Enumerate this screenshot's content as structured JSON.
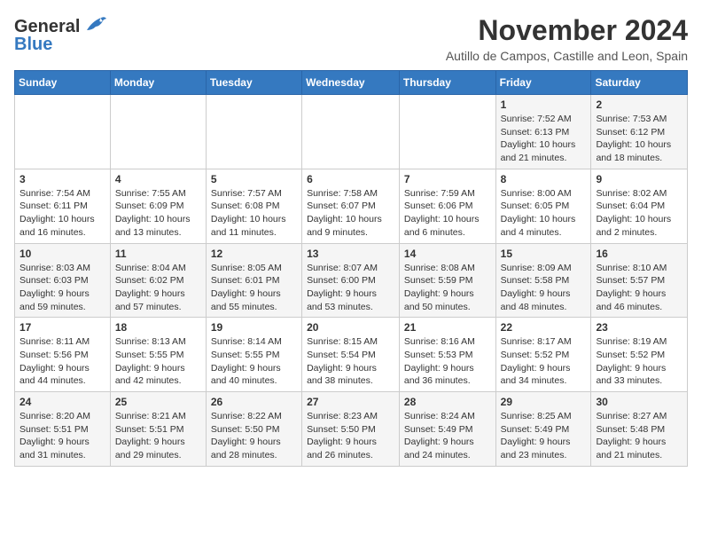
{
  "header": {
    "logo_line1": "General",
    "logo_line2": "Blue",
    "month_title": "November 2024",
    "location": "Autillo de Campos, Castille and Leon, Spain"
  },
  "weekdays": [
    "Sunday",
    "Monday",
    "Tuesday",
    "Wednesday",
    "Thursday",
    "Friday",
    "Saturday"
  ],
  "weeks": [
    [
      {
        "day": "",
        "info": ""
      },
      {
        "day": "",
        "info": ""
      },
      {
        "day": "",
        "info": ""
      },
      {
        "day": "",
        "info": ""
      },
      {
        "day": "",
        "info": ""
      },
      {
        "day": "1",
        "info": "Sunrise: 7:52 AM\nSunset: 6:13 PM\nDaylight: 10 hours and 21 minutes."
      },
      {
        "day": "2",
        "info": "Sunrise: 7:53 AM\nSunset: 6:12 PM\nDaylight: 10 hours and 18 minutes."
      }
    ],
    [
      {
        "day": "3",
        "info": "Sunrise: 7:54 AM\nSunset: 6:11 PM\nDaylight: 10 hours and 16 minutes."
      },
      {
        "day": "4",
        "info": "Sunrise: 7:55 AM\nSunset: 6:09 PM\nDaylight: 10 hours and 13 minutes."
      },
      {
        "day": "5",
        "info": "Sunrise: 7:57 AM\nSunset: 6:08 PM\nDaylight: 10 hours and 11 minutes."
      },
      {
        "day": "6",
        "info": "Sunrise: 7:58 AM\nSunset: 6:07 PM\nDaylight: 10 hours and 9 minutes."
      },
      {
        "day": "7",
        "info": "Sunrise: 7:59 AM\nSunset: 6:06 PM\nDaylight: 10 hours and 6 minutes."
      },
      {
        "day": "8",
        "info": "Sunrise: 8:00 AM\nSunset: 6:05 PM\nDaylight: 10 hours and 4 minutes."
      },
      {
        "day": "9",
        "info": "Sunrise: 8:02 AM\nSunset: 6:04 PM\nDaylight: 10 hours and 2 minutes."
      }
    ],
    [
      {
        "day": "10",
        "info": "Sunrise: 8:03 AM\nSunset: 6:03 PM\nDaylight: 9 hours and 59 minutes."
      },
      {
        "day": "11",
        "info": "Sunrise: 8:04 AM\nSunset: 6:02 PM\nDaylight: 9 hours and 57 minutes."
      },
      {
        "day": "12",
        "info": "Sunrise: 8:05 AM\nSunset: 6:01 PM\nDaylight: 9 hours and 55 minutes."
      },
      {
        "day": "13",
        "info": "Sunrise: 8:07 AM\nSunset: 6:00 PM\nDaylight: 9 hours and 53 minutes."
      },
      {
        "day": "14",
        "info": "Sunrise: 8:08 AM\nSunset: 5:59 PM\nDaylight: 9 hours and 50 minutes."
      },
      {
        "day": "15",
        "info": "Sunrise: 8:09 AM\nSunset: 5:58 PM\nDaylight: 9 hours and 48 minutes."
      },
      {
        "day": "16",
        "info": "Sunrise: 8:10 AM\nSunset: 5:57 PM\nDaylight: 9 hours and 46 minutes."
      }
    ],
    [
      {
        "day": "17",
        "info": "Sunrise: 8:11 AM\nSunset: 5:56 PM\nDaylight: 9 hours and 44 minutes."
      },
      {
        "day": "18",
        "info": "Sunrise: 8:13 AM\nSunset: 5:55 PM\nDaylight: 9 hours and 42 minutes."
      },
      {
        "day": "19",
        "info": "Sunrise: 8:14 AM\nSunset: 5:55 PM\nDaylight: 9 hours and 40 minutes."
      },
      {
        "day": "20",
        "info": "Sunrise: 8:15 AM\nSunset: 5:54 PM\nDaylight: 9 hours and 38 minutes."
      },
      {
        "day": "21",
        "info": "Sunrise: 8:16 AM\nSunset: 5:53 PM\nDaylight: 9 hours and 36 minutes."
      },
      {
        "day": "22",
        "info": "Sunrise: 8:17 AM\nSunset: 5:52 PM\nDaylight: 9 hours and 34 minutes."
      },
      {
        "day": "23",
        "info": "Sunrise: 8:19 AM\nSunset: 5:52 PM\nDaylight: 9 hours and 33 minutes."
      }
    ],
    [
      {
        "day": "24",
        "info": "Sunrise: 8:20 AM\nSunset: 5:51 PM\nDaylight: 9 hours and 31 minutes."
      },
      {
        "day": "25",
        "info": "Sunrise: 8:21 AM\nSunset: 5:51 PM\nDaylight: 9 hours and 29 minutes."
      },
      {
        "day": "26",
        "info": "Sunrise: 8:22 AM\nSunset: 5:50 PM\nDaylight: 9 hours and 28 minutes."
      },
      {
        "day": "27",
        "info": "Sunrise: 8:23 AM\nSunset: 5:50 PM\nDaylight: 9 hours and 26 minutes."
      },
      {
        "day": "28",
        "info": "Sunrise: 8:24 AM\nSunset: 5:49 PM\nDaylight: 9 hours and 24 minutes."
      },
      {
        "day": "29",
        "info": "Sunrise: 8:25 AM\nSunset: 5:49 PM\nDaylight: 9 hours and 23 minutes."
      },
      {
        "day": "30",
        "info": "Sunrise: 8:27 AM\nSunset: 5:48 PM\nDaylight: 9 hours and 21 minutes."
      }
    ]
  ]
}
